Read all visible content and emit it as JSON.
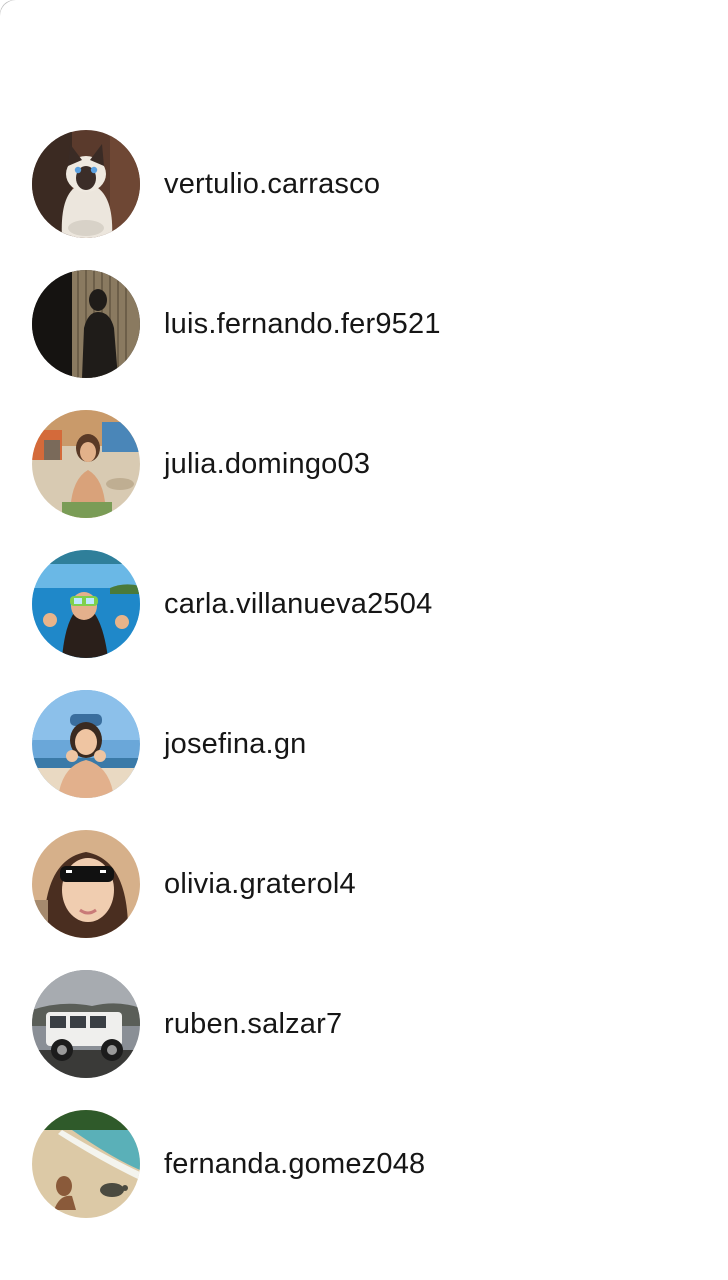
{
  "users": [
    {
      "username": "vertulio.carrasco",
      "avatar_icon": "siamese-cat-photo"
    },
    {
      "username": "luis.fernando.fer9521",
      "avatar_icon": "silhouette-photo"
    },
    {
      "username": "julia.domingo03",
      "avatar_icon": "beach-girl-photo"
    },
    {
      "username": "carla.villanueva2504",
      "avatar_icon": "snorkel-photo"
    },
    {
      "username": "josefina.gn",
      "avatar_icon": "sky-selfie-photo"
    },
    {
      "username": "olivia.graterol4",
      "avatar_icon": "sunglasses-selfie-photo"
    },
    {
      "username": "ruben.salzar7",
      "avatar_icon": "jeep-photo"
    },
    {
      "username": "fernanda.gomez048",
      "avatar_icon": "beach-turtle-photo"
    }
  ]
}
